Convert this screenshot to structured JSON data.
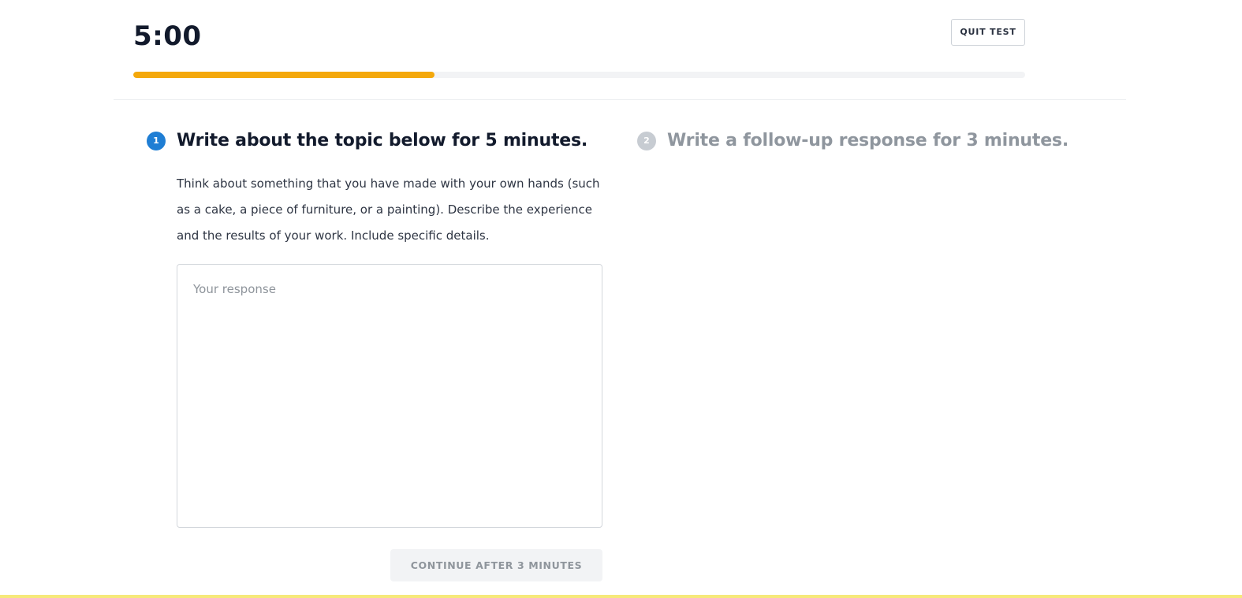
{
  "header": {
    "timer": "5:00",
    "quit_label": "QUIT TEST",
    "progress": 0.338
  },
  "steps": [
    {
      "number": "1",
      "title": "Write about the topic below for 5 minutes.",
      "state": "active"
    },
    {
      "number": "2",
      "title": "Write a follow-up response for 3 minutes.",
      "state": "inactive"
    }
  ],
  "prompt": {
    "text": "Think about something that you have made with your own hands (such as a cake, a piece of furniture, or a painting). Describe the experience and the results of your work. Include specific details."
  },
  "response": {
    "value": "",
    "placeholder": "Your response"
  },
  "continue": {
    "label": "CONTINUE AFTER 3 MINUTES",
    "enabled": false
  },
  "colors": {
    "accent": "#1f7ed4",
    "progress": "#f4a80b",
    "disabled": "#f2f3f5"
  }
}
